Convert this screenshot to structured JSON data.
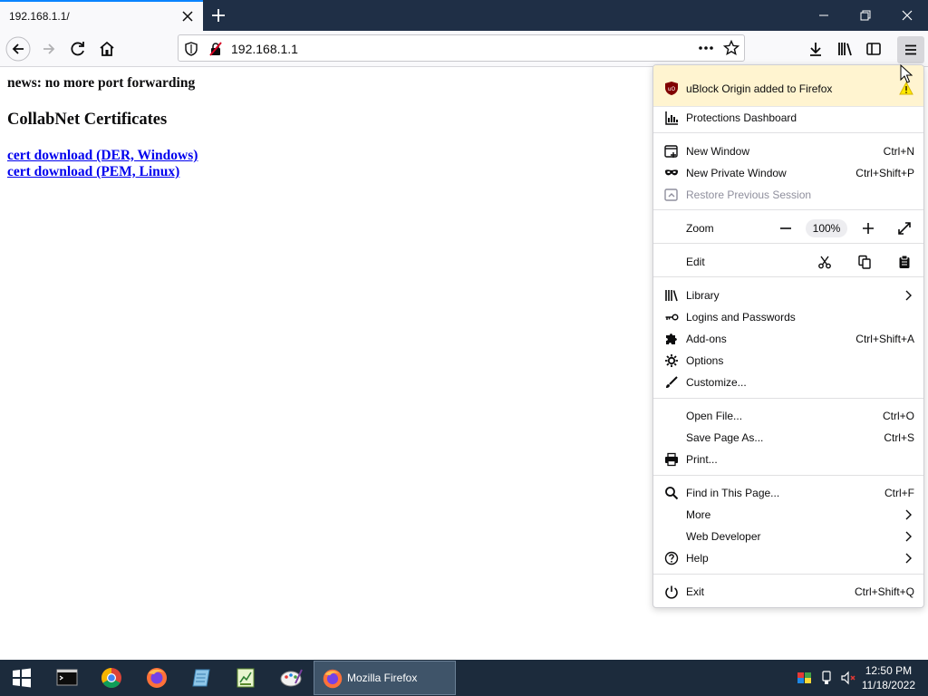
{
  "tab": {
    "title": "192.168.1.1/"
  },
  "urlbar": {
    "url": "192.168.1.1"
  },
  "page": {
    "news": "news: no more port forwarding",
    "heading": "CollabNet Certificates",
    "links": [
      "cert download (DER, Windows)",
      "cert download (PEM, Linux)"
    ]
  },
  "menu": {
    "notice": "uBlock Origin added to Firefox",
    "items": {
      "protections": {
        "label": "Protections Dashboard"
      },
      "new_window": {
        "label": "New Window",
        "shortcut": "Ctrl+N"
      },
      "private_window": {
        "label": "New Private Window",
        "shortcut": "Ctrl+Shift+P"
      },
      "restore_session": {
        "label": "Restore Previous Session"
      },
      "zoom": {
        "label": "Zoom",
        "value": "100%"
      },
      "edit": {
        "label": "Edit"
      },
      "library": {
        "label": "Library"
      },
      "logins": {
        "label": "Logins and Passwords"
      },
      "addons": {
        "label": "Add-ons",
        "shortcut": "Ctrl+Shift+A"
      },
      "options": {
        "label": "Options"
      },
      "customize": {
        "label": "Customize..."
      },
      "open_file": {
        "label": "Open File...",
        "shortcut": "Ctrl+O"
      },
      "save_page": {
        "label": "Save Page As...",
        "shortcut": "Ctrl+S"
      },
      "print": {
        "label": "Print..."
      },
      "find": {
        "label": "Find in This Page...",
        "shortcut": "Ctrl+F"
      },
      "more": {
        "label": "More"
      },
      "web_dev": {
        "label": "Web Developer"
      },
      "help": {
        "label": "Help"
      },
      "exit": {
        "label": "Exit",
        "shortcut": "Ctrl+Shift+Q"
      }
    }
  },
  "taskbar": {
    "firefox_label": "Mozilla Firefox",
    "time": "12:50 PM",
    "date": "11/18/2022"
  },
  "colors": {
    "tabstrip": "#1f2f46",
    "accent": "#0a84ff",
    "notice_bg": "#fff4d0",
    "link": "#0000ee",
    "taskbar": "#1c2b3c"
  }
}
